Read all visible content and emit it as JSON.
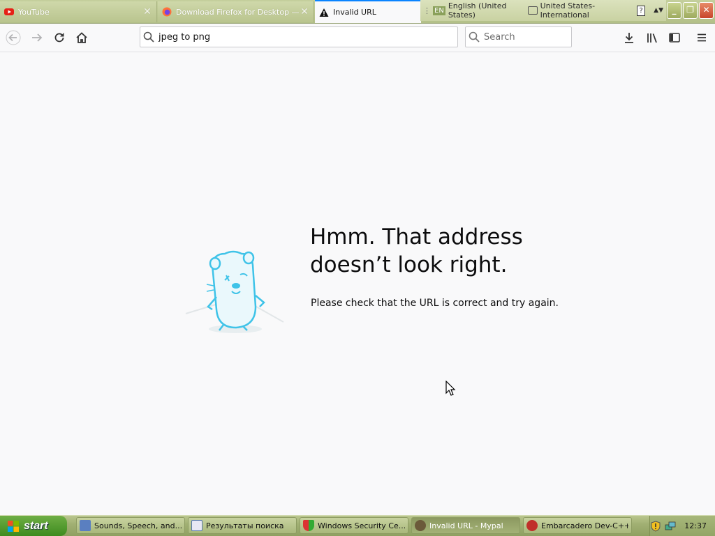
{
  "tabs": [
    {
      "title": "YouTube",
      "icon": "youtube-icon",
      "active": false
    },
    {
      "title": "Download Firefox for Desktop — M",
      "icon": "firefox-icon",
      "active": false
    },
    {
      "title": "Invalid URL",
      "icon": "warning-icon",
      "active": true
    }
  ],
  "language_bar": {
    "lang_code": "EN",
    "language": "English (United States)",
    "keyboard": "United States-International",
    "help": "?"
  },
  "navbar": {
    "url_value": "jpeg to png",
    "search_placeholder": "Search"
  },
  "error_page": {
    "title": "Hmm. That address doesn’t look right.",
    "description": "Please check that the URL is correct and try again."
  },
  "taskbar": {
    "start_label": "start",
    "items": [
      {
        "label": "Sounds, Speech, and...",
        "icon": "control-panel-icon",
        "active": false
      },
      {
        "label": "Результаты поиска",
        "icon": "search-results-icon",
        "active": false
      },
      {
        "label": "Windows Security Ce...",
        "icon": "security-shield-icon",
        "active": false
      },
      {
        "label": "Invalid URL - Mypal",
        "icon": "mypal-icon",
        "active": true
      },
      {
        "label": "Embarcadero Dev-C++",
        "icon": "devcpp-icon",
        "active": false
      }
    ],
    "clock": "12:37"
  },
  "colors": {
    "accent": "#0a84ff",
    "page_bg": "#f9f9fa",
    "titlebar": "#b3c088",
    "start_button": "#3d8b1f",
    "close_button": "#c8452a"
  }
}
